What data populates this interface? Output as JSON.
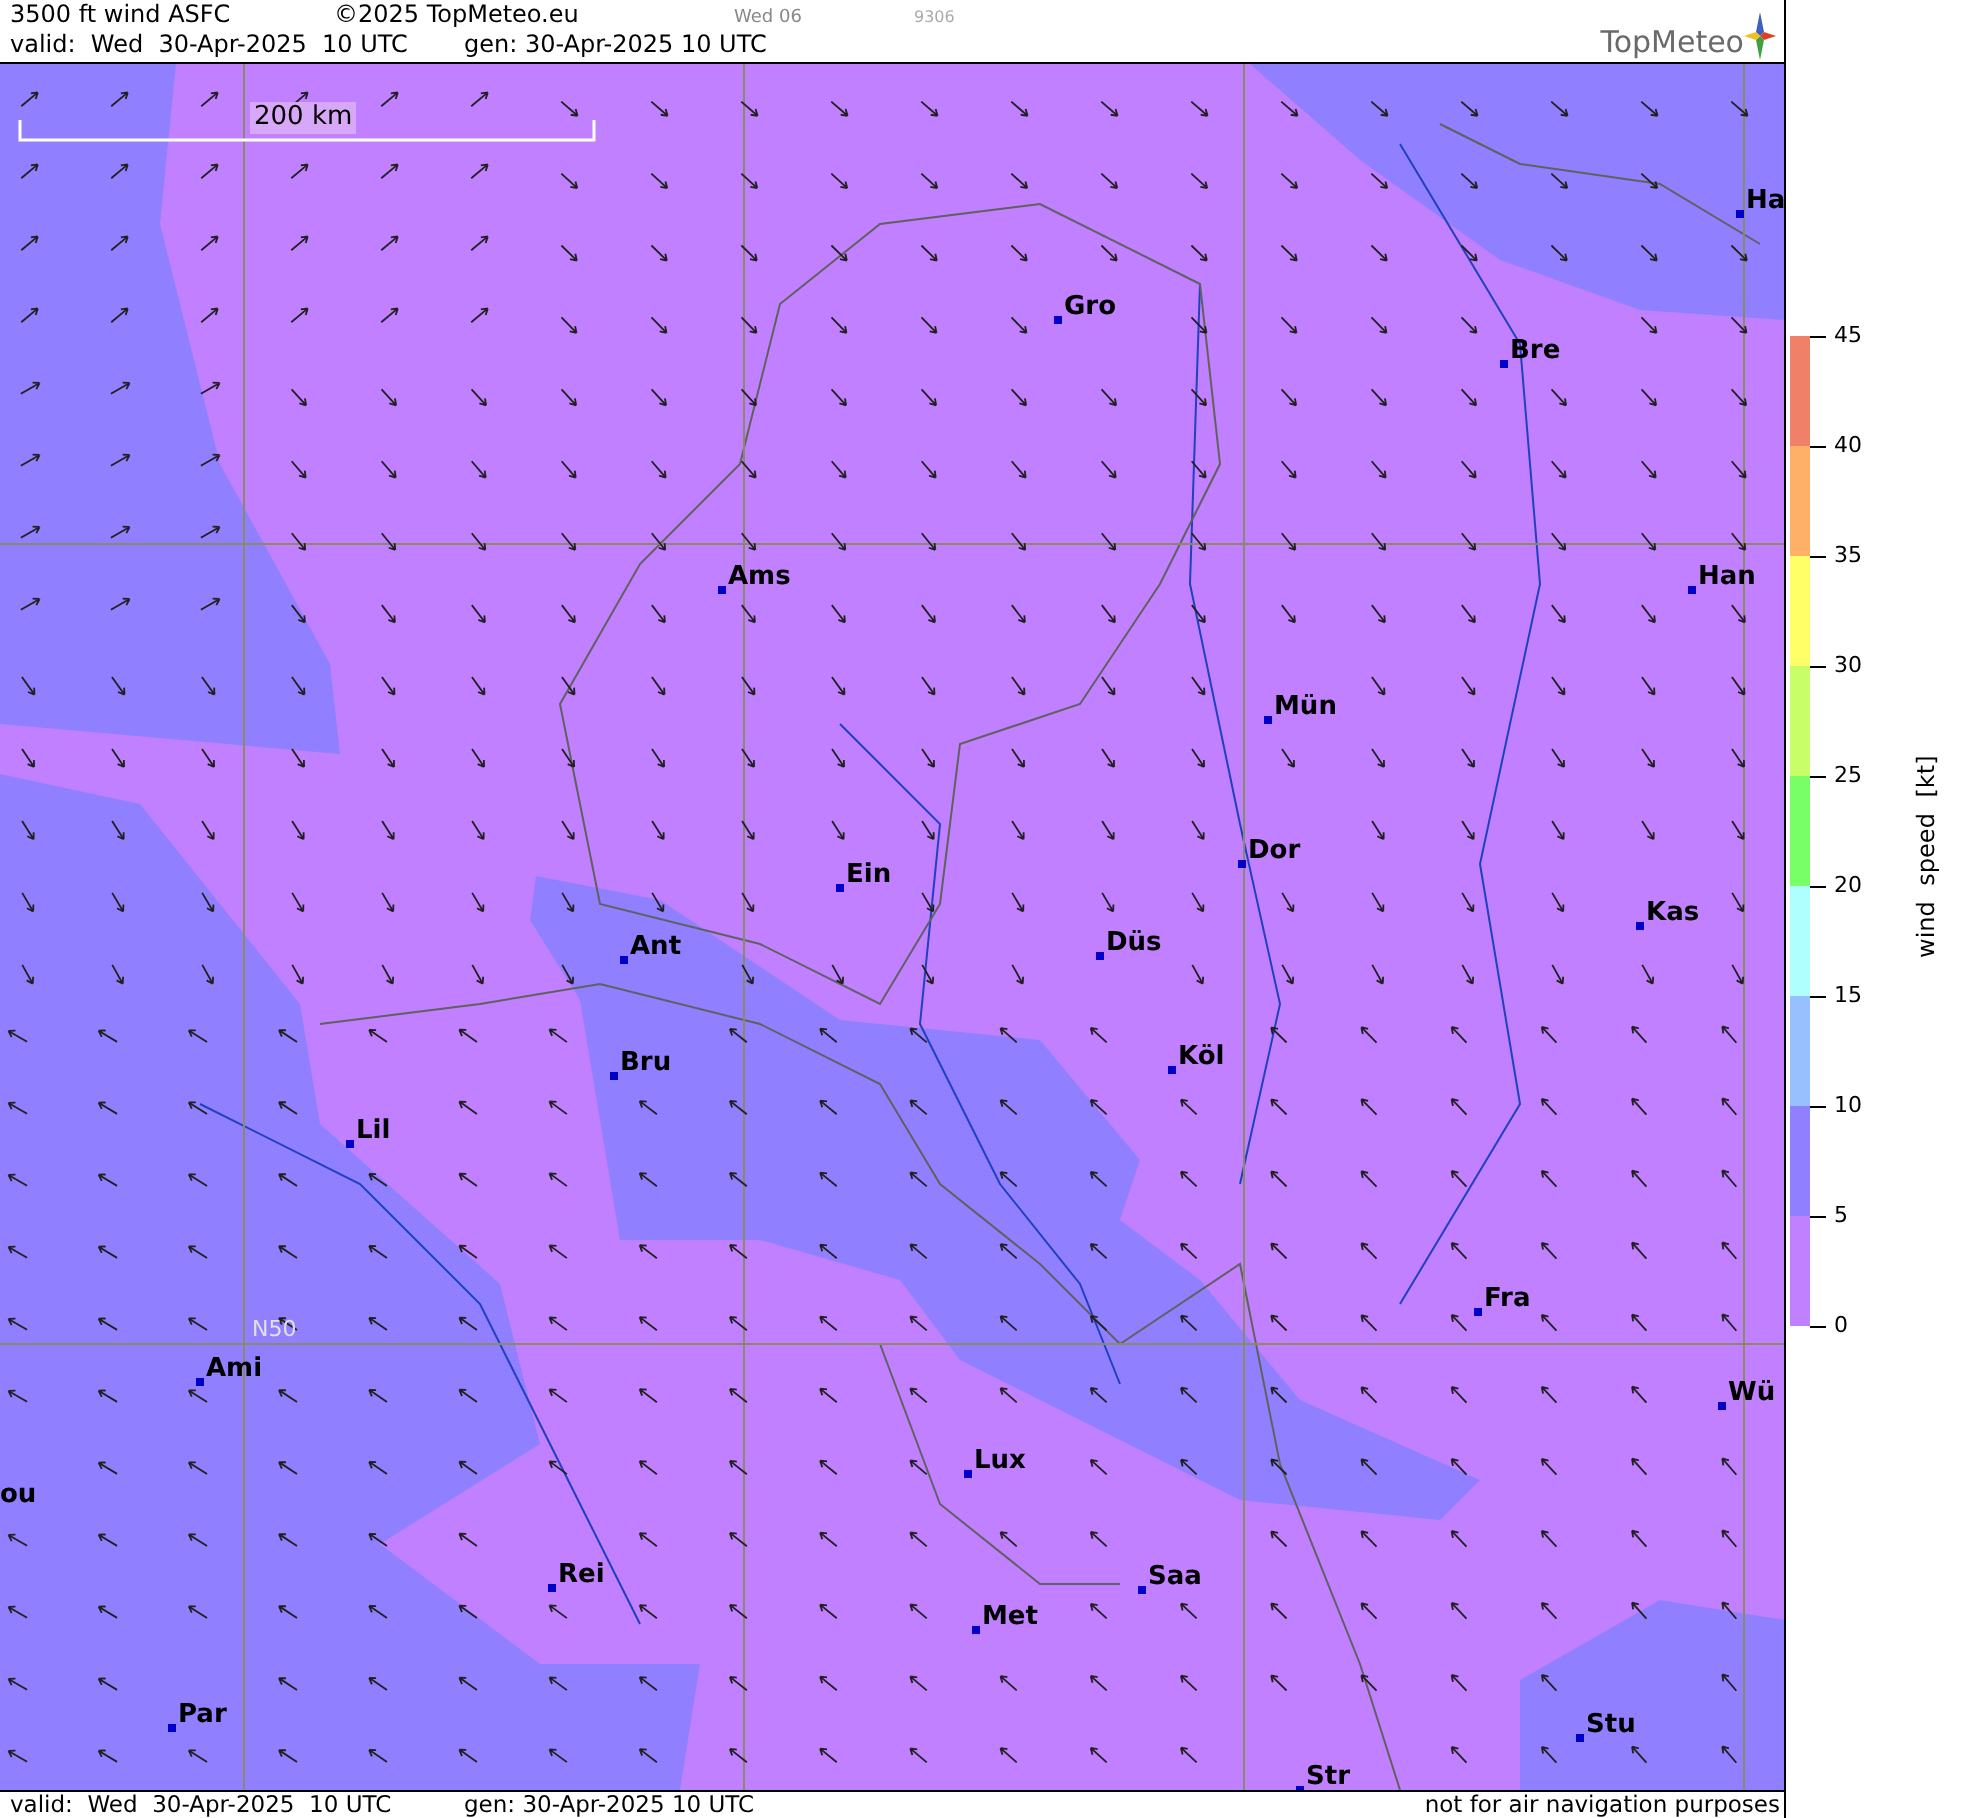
{
  "header": {
    "title": "3500 ft wind ASFC",
    "copyright": "©2025 TopMeteo.eu",
    "day": "Wed 06",
    "code": "9306",
    "valid": "valid:  Wed  30-Apr-2025  10 UTC",
    "gen": "gen: 30-Apr-2025 10 UTC",
    "logo": "TopMeteo"
  },
  "map": {
    "scale": "200 km",
    "latitude_label": "N50",
    "cities": [
      {
        "name": "Ha"
      },
      {
        "name": "Gro"
      },
      {
        "name": "Bre"
      },
      {
        "name": "Ams"
      },
      {
        "name": "Han"
      },
      {
        "name": "Mün"
      },
      {
        "name": "Dor"
      },
      {
        "name": "Ein"
      },
      {
        "name": "Kas"
      },
      {
        "name": "Düs"
      },
      {
        "name": "Ant"
      },
      {
        "name": "Köl"
      },
      {
        "name": "Bru"
      },
      {
        "name": "Lil"
      },
      {
        "name": "Fra"
      },
      {
        "name": "Ami"
      },
      {
        "name": "Wü"
      },
      {
        "name": "Lux"
      },
      {
        "name": "ou"
      },
      {
        "name": "Rei"
      },
      {
        "name": "Saa"
      },
      {
        "name": "Met"
      },
      {
        "name": "Par"
      },
      {
        "name": "Stu"
      },
      {
        "name": "Str"
      }
    ]
  },
  "legend": {
    "title": "wind speed [kt]",
    "ticks": [
      "45",
      "40",
      "35",
      "30",
      "25",
      "20",
      "15",
      "10",
      "5",
      "0"
    ],
    "bands": [
      {
        "color": "#f08068"
      },
      {
        "color": "#ffb068"
      },
      {
        "color": "#ffff68"
      },
      {
        "color": "#c8ff68"
      },
      {
        "color": "#78ff68"
      },
      {
        "color": "#b0ffff"
      },
      {
        "color": "#98c0ff"
      },
      {
        "color": "#9080ff"
      },
      {
        "color": "#c080ff"
      }
    ]
  },
  "footer": {
    "valid": "valid:  Wed  30-Apr-2025  10 UTC",
    "gen": "gen: 30-Apr-2025 10 UTC",
    "note": "not for air navigation purposes"
  }
}
